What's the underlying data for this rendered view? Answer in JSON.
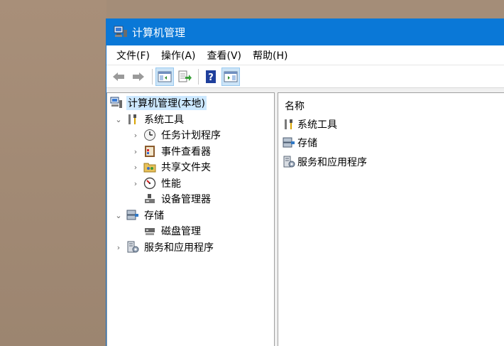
{
  "window": {
    "title": "计算机管理"
  },
  "menubar": {
    "items": [
      "文件(F)",
      "操作(A)",
      "查看(V)",
      "帮助(H)"
    ]
  },
  "toolbar": {
    "icons": [
      "back-arrow-icon",
      "forward-arrow-icon",
      "show-hide-tree-icon",
      "export-list-icon",
      "help-icon",
      "show-hide-action-pane-icon"
    ]
  },
  "tree": {
    "root": "计算机管理(本地)",
    "system_tools": "系统工具",
    "task_scheduler": "任务计划程序",
    "event_viewer": "事件查看器",
    "shared_folders": "共享文件夹",
    "performance": "性能",
    "device_manager": "设备管理器",
    "storage": "存储",
    "disk_management": "磁盘管理",
    "services_apps": "服务和应用程序"
  },
  "list": {
    "header_name": "名称",
    "items": [
      "系统工具",
      "存储",
      "服务和应用程序"
    ]
  },
  "colors": {
    "titlebar": "#0a78d7",
    "selection": "#cce8ff",
    "desktop": "#a48d78"
  }
}
